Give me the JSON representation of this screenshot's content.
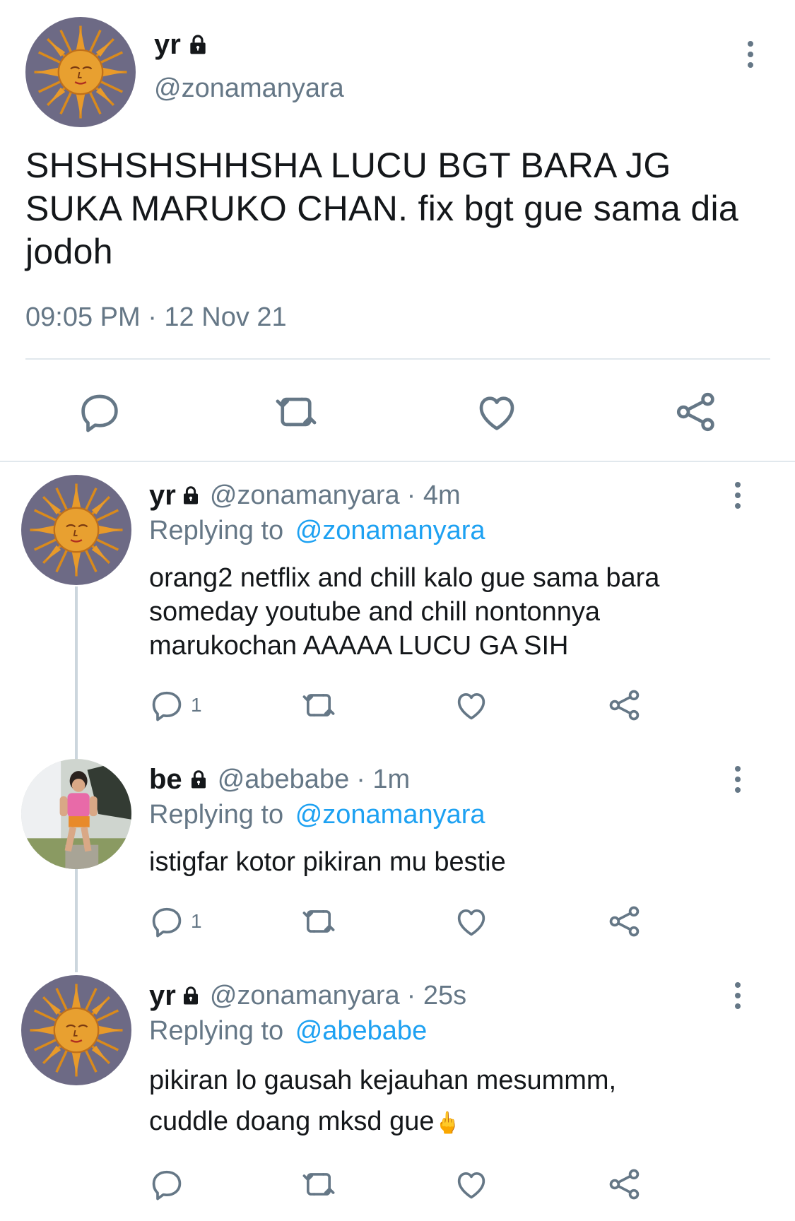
{
  "colors": {
    "text": "#14171a",
    "muted": "#657786",
    "link": "#1da1f2",
    "divider": "#e1e8ed"
  },
  "main_tweet": {
    "name": "yr",
    "handle": "@zonamanyara",
    "text": "SHSHSHSHHSHA LUCU BGT BARA JG SUKA MARUKO CHAN. fix bgt gue sama dia jodoh",
    "timestamp": "09:05 PM · 12 Nov 21",
    "icons": [
      "lock-icon",
      "more-icon",
      "reply-icon",
      "retweet-icon",
      "like-icon",
      "share-icon"
    ]
  },
  "replies": [
    {
      "name": "yr",
      "handle": "@zonamanyara",
      "time": "· 4m",
      "replying_label": "Replying to",
      "replying_to": "@zonamanyara",
      "text": "orang2 netflix and chill kalo gue sama bara someday youtube and chill nontonnya marukochan AAAAA LUCU GA SIH",
      "reply_count": "1"
    },
    {
      "name": "be",
      "handle": "@abebabe",
      "time": "· 1m",
      "replying_label": "Replying to",
      "replying_to": "@zonamanyara",
      "text": "istigfar kotor pikiran mu bestie",
      "reply_count": "1"
    },
    {
      "name": "yr",
      "handle": "@zonamanyara",
      "time": "· 25s",
      "replying_label": "Replying to",
      "replying_to": "@abebabe",
      "text_line1": "pikiran lo gausah kejauhan mesummm,",
      "text_line2": "cuddle doang mksd gue",
      "emoji": "🖕",
      "reply_count": ""
    }
  ]
}
